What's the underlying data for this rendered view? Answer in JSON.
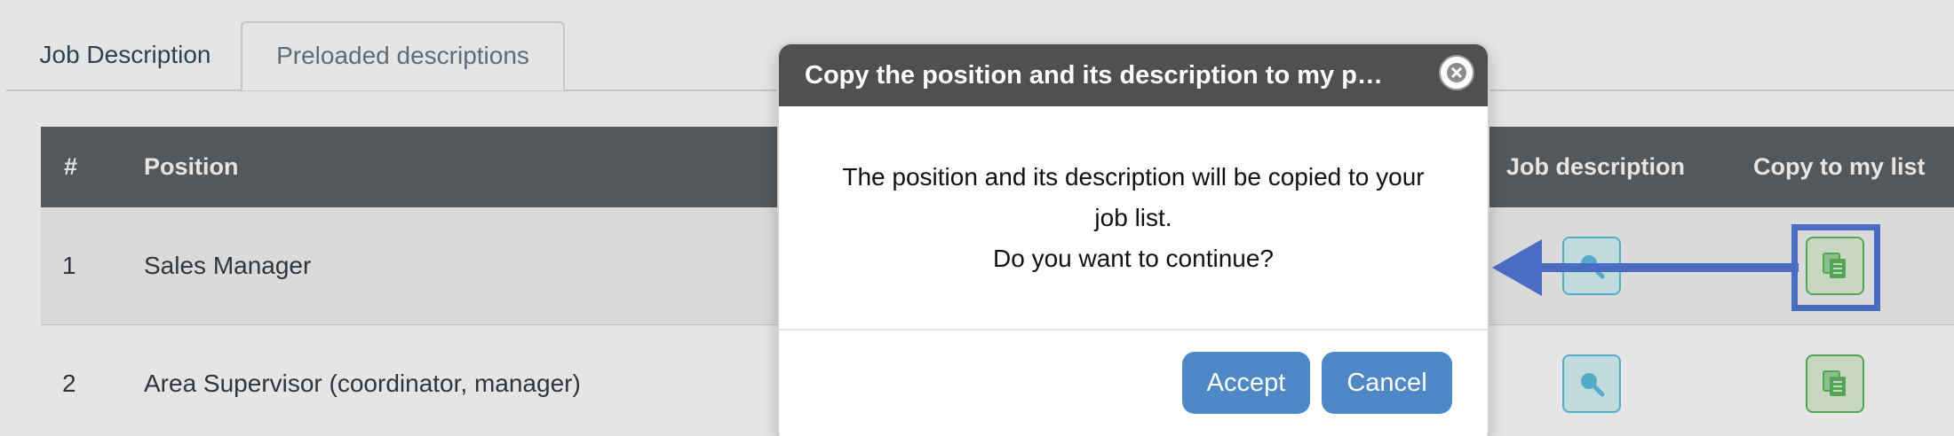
{
  "tabs": [
    {
      "label": "Job Description"
    },
    {
      "label": "Preloaded descriptions"
    }
  ],
  "table": {
    "headers": {
      "num": "#",
      "position": "Position",
      "job_description": "Job description",
      "copy": "Copy to my list"
    },
    "rows": [
      {
        "num": "1",
        "position": "Sales Manager"
      },
      {
        "num": "2",
        "position": "Area Supervisor (coordinator, manager)"
      }
    ]
  },
  "modal": {
    "title": "Copy the position and its description to my pos…",
    "message": "The position and its description will be copied to your job list.",
    "question": "Do you want to continue?",
    "accept_label": "Accept",
    "cancel_label": "Cancel"
  },
  "icons": {
    "search": "search-icon",
    "copy": "copy-icon",
    "close": "close-icon"
  },
  "colors": {
    "header_bg": "#5e6266",
    "modal_header_bg": "#505050",
    "button_bg": "#4f88c6",
    "annotation": "#4a6cc3",
    "search_btn": "#5bc0de",
    "copy_btn": "#5cb85c"
  }
}
